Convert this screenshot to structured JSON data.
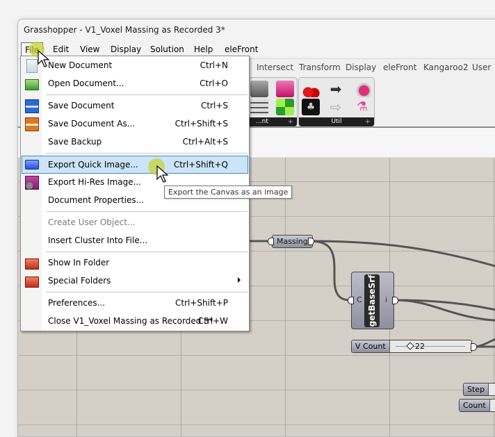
{
  "window": {
    "title": "Grasshopper - V1_Voxel Massing as Recorded 3*"
  },
  "menubar": [
    {
      "label": "File",
      "active": true
    },
    {
      "label": "Edit"
    },
    {
      "label": "View"
    },
    {
      "label": "Display"
    },
    {
      "label": "Solution"
    },
    {
      "label": "Help"
    },
    {
      "label": "eleFront"
    }
  ],
  "ribbon_tabs": [
    "Intersect",
    "Transform",
    "Display",
    "eleFront",
    "Kangaroo2",
    "User"
  ],
  "ribbon_panels": [
    {
      "label": "...nt"
    },
    {
      "label": "Util"
    }
  ],
  "file_menu": {
    "items": [
      {
        "label": "New Document",
        "shortcut": "Ctrl+N",
        "icon": "new-document-icon"
      },
      {
        "label": "Open Document...",
        "shortcut": "Ctrl+O",
        "icon": "open-folder-icon"
      },
      {
        "label": "Save Document",
        "shortcut": "Ctrl+S",
        "icon": "save-disk-icon"
      },
      {
        "label": "Save Document As...",
        "shortcut": "Ctrl+Shift+S",
        "icon": "save-as-disk-icon"
      },
      {
        "label": "Save Backup",
        "shortcut": "Ctrl+Alt+S"
      },
      {
        "label": "Export Quick Image...",
        "shortcut": "Ctrl+Shift+Q",
        "icon": "export-image-icon",
        "highlighted": true
      },
      {
        "label": "Export Hi-Res Image...",
        "icon": "export-hires-icon"
      },
      {
        "label": "Document Properties..."
      },
      {
        "label": "Create User Object...",
        "disabled": true
      },
      {
        "label": "Insert Cluster Into File..."
      },
      {
        "label": "Show In Folder",
        "icon": "folder-icon"
      },
      {
        "label": "Special Folders",
        "icon": "folder-icon",
        "submenu": true
      },
      {
        "label": "Preferences...",
        "shortcut": "Ctrl+Shift+P"
      },
      {
        "label": "Close V1_Voxel Massing as Recorded 3*",
        "shortcut": "Ctrl+W"
      }
    ]
  },
  "tooltip": "Export the Canvas as an image",
  "canvas": {
    "nodes": {
      "massing": {
        "label": "Massing"
      },
      "getbasesrf": {
        "label": "getBaseSrf",
        "input": "C",
        "output": "i"
      },
      "vcount": {
        "label": "V Count",
        "value": "22"
      },
      "step": {
        "label": "Step"
      },
      "count": {
        "label": "Count"
      }
    }
  },
  "colors": {
    "menu_highlight": "#cce4f7",
    "menu_highlight_border": "#3d8ad0",
    "canvas_bg": "#d4d0c8"
  }
}
